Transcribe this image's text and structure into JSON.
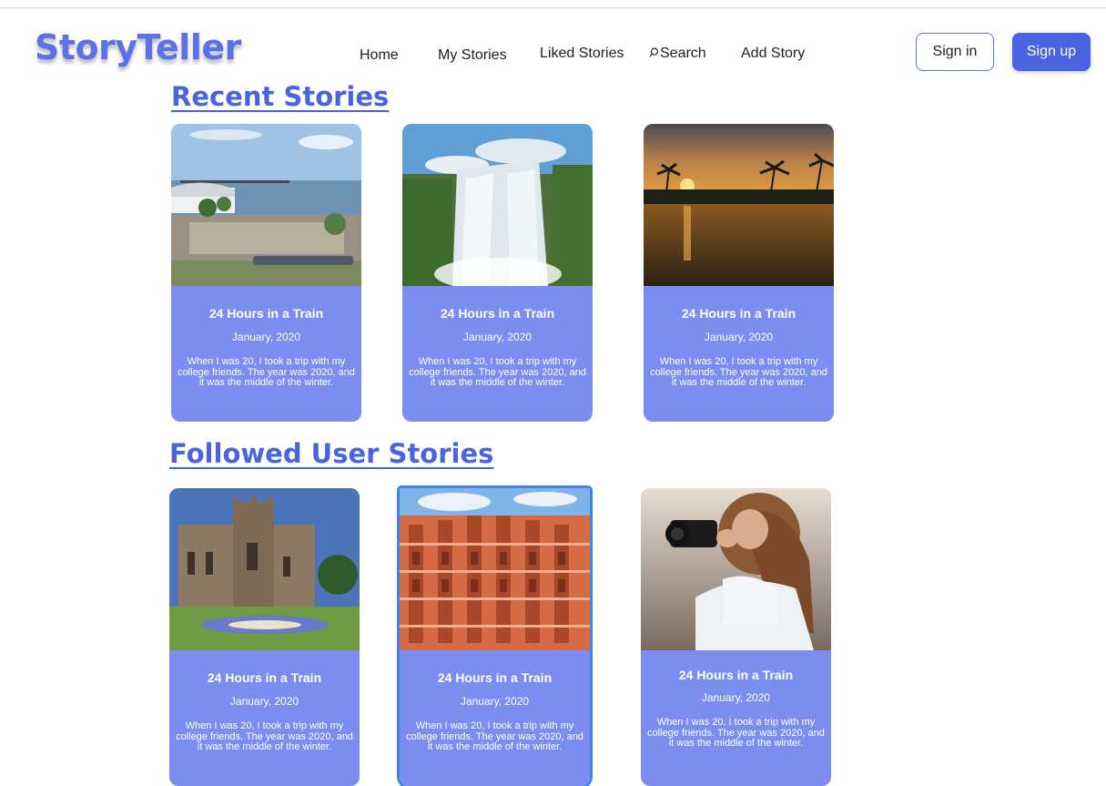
{
  "brand": {
    "name": "StoryTeller"
  },
  "nav": {
    "home": "Home",
    "my_stories": "My Stories",
    "liked_stories": "Liked Stories",
    "search": "Search",
    "add_story": "Add Story"
  },
  "auth": {
    "sign_in": "Sign in",
    "sign_up": "Sign up"
  },
  "sections": {
    "recent": {
      "title": "Recent Stories"
    },
    "followed": {
      "title": "Followed User Stories"
    }
  },
  "recent_stories": [
    {
      "title": "24 Hours in a Train",
      "date": "January, 2020",
      "excerpt": "When I was 20, I took a trip with my college friends. The year was 2020, and it was the middle of the winter.",
      "image": "waterfront-plaza-bridge"
    },
    {
      "title": "24 Hours in a Train",
      "date": "January, 2020",
      "excerpt": "When I was 20, I took a trip with my college friends. The year was 2020, and it was the middle of the winter.",
      "image": "waterfall"
    },
    {
      "title": "24 Hours in a Train",
      "date": "January, 2020",
      "excerpt": "When I was 20, I took a trip with my college friends. The year was 2020, and it was the middle of the winter.",
      "image": "sunset-palms-river"
    }
  ],
  "followed_stories": [
    {
      "title": "24 Hours in a Train",
      "date": "January, 2020",
      "excerpt": "When I was 20, I took a trip with my college friends. The year was 2020, and it was the middle of the winter.",
      "image": "cathedral"
    },
    {
      "title": "24 Hours in a Train",
      "date": "January, 2020",
      "excerpt": "When I was 20, I took a trip with my college friends. The year was 2020, and it was the middle of the winter.",
      "image": "palace-facade"
    },
    {
      "title": "24 Hours in a Train",
      "date": "January, 2020",
      "excerpt": "When I was 20, I took a trip with my college friends. The year was 2020, and it was the middle of the winter.",
      "image": "photographer"
    }
  ],
  "colors": {
    "brand": "#5b72e6",
    "accent": "#4a63e0",
    "card": "#7b8ef0"
  }
}
